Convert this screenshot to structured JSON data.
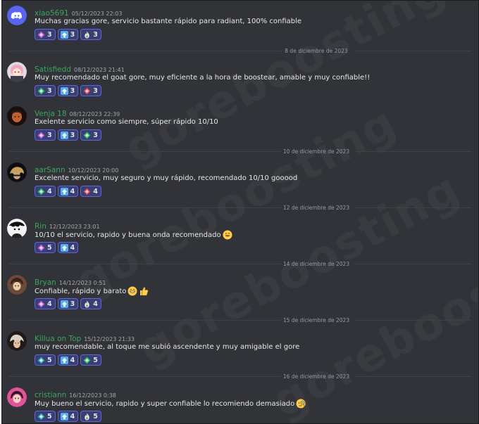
{
  "watermark_text": "goreboosting",
  "colors": {
    "background": "#313338",
    "username": "#3ba55c",
    "reaction_border": "#5865f2",
    "reaction_bg": "#3b3f6b"
  },
  "messages": [
    {
      "username": "xiao5691",
      "timestamp": "05/12/2023 22:03",
      "text": "Muchas gracias gore, servicio bastante rápido para radiant, 100% confiable",
      "emoji": [],
      "reactions": [
        {
          "icon": "rank-badge-purple-icon",
          "count": "3"
        },
        {
          "icon": "up-arrow-icon",
          "count": "3"
        },
        {
          "icon": "flame-rank-icon",
          "count": "3"
        }
      ]
    },
    {
      "username": "Satisfiedd",
      "timestamp": "08/12/2023 21:41",
      "text": "Muy recomendado el goat gore, muy eficiente a la hora de boostear, amable y muy confiable!!",
      "emoji": [],
      "reactions": [
        {
          "icon": "rank-badge-green-icon",
          "count": "3"
        },
        {
          "icon": "up-arrow-icon",
          "count": "3"
        },
        {
          "icon": "rank-badge-red-icon",
          "count": "3"
        }
      ]
    },
    {
      "username": "Venja 18",
      "timestamp": "08/12/2023 22:39",
      "text": "Exelente servicio como siempre, súper rápido 10/10",
      "emoji": [],
      "reactions": [
        {
          "icon": "rank-badge-purple-icon",
          "count": "3"
        },
        {
          "icon": "up-arrow-icon",
          "count": "3"
        },
        {
          "icon": "rank-badge-green-icon",
          "count": "3"
        }
      ]
    },
    {
      "username": "aarSann",
      "timestamp": "10/12/2023 20:00",
      "text": "Excelente servicio, muy seguro y muy rápido, recomendado 10/10 gooood",
      "emoji": [],
      "reactions": [
        {
          "icon": "rank-badge-green-icon",
          "count": "4"
        },
        {
          "icon": "up-arrow-icon",
          "count": "4"
        },
        {
          "icon": "rank-badge-red-icon",
          "count": "4"
        }
      ]
    },
    {
      "username": "Rin",
      "timestamp": "12/12/2023 23:01",
      "text": "10/10 el servicio, rapido y buena onda recomendado",
      "emoji": [
        "grin-emoji"
      ],
      "reactions": [
        {
          "icon": "rank-badge-purple-icon",
          "count": "5"
        },
        {
          "icon": "up-arrow-icon",
          "count": "4"
        }
      ]
    },
    {
      "username": "Bryan",
      "timestamp": "14/12/2023 0:51",
      "text": "Confiable, rápido y barato",
      "emoji": [
        "grin-emoji",
        "thumbs-up-emoji"
      ],
      "reactions": [
        {
          "icon": "rank-badge-purple-icon",
          "count": "4"
        },
        {
          "icon": "up-arrow-icon",
          "count": "3"
        },
        {
          "icon": "flame-rank-icon",
          "count": "4"
        }
      ]
    },
    {
      "username": "Killua on Top",
      "timestamp": "15/12/2023 21:33",
      "text": "muy recomendable, al toque me subió ascendente y muy amigable el gore",
      "emoji": [],
      "reactions": [
        {
          "icon": "rank-badge-teal-icon",
          "count": "5"
        },
        {
          "icon": "up-arrow-icon",
          "count": "4"
        },
        {
          "icon": "rank-badge-green-icon",
          "count": "5"
        }
      ]
    },
    {
      "username": "cristiann",
      "timestamp": "16/12/2023 0:38",
      "text": "Muy bueno el servicio, rapido y super confiable lo recomiendo demasiado",
      "emoji": [
        "monocle-emoji"
      ],
      "reactions": [
        {
          "icon": "rank-badge-teal-icon",
          "count": "5"
        },
        {
          "icon": "up-arrow-icon",
          "count": "4"
        },
        {
          "icon": "flame-rank-icon",
          "count": "5"
        }
      ]
    }
  ],
  "date_dividers": [
    "8 de diciembre de 2023",
    "10 de diciembre de 2023",
    "10 de diciembre de 2023",
    "12 de diciembre de 2023",
    "14 de diciembre de 2023",
    "15 de diciembre de 2023",
    "16 de diciembre de 2023"
  ]
}
